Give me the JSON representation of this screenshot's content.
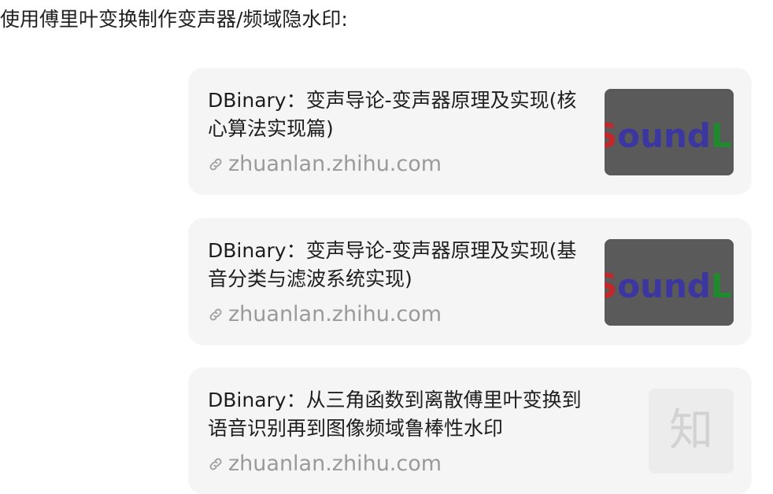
{
  "intro": "使用傅里叶变换制作变声器/频域隐水印:",
  "cards": [
    {
      "author": "DBinary",
      "sep": "：",
      "title": "变声导论-变声器原理及实现(核心算法实现篇)",
      "url": "zhuanlan.zhihu.com",
      "thumb_text": "SoundLa",
      "thumb_kind": "soundlab"
    },
    {
      "author": "DBinary",
      "sep": "：",
      "title": "变声导论-变声器原理及实现(基音分类与滤波系统实现)",
      "url": "zhuanlan.zhihu.com",
      "thumb_text": "SoundLa",
      "thumb_kind": "soundlab"
    },
    {
      "author": "DBinary",
      "sep": "：",
      "title": "从三角函数到离散傅里叶变换到语音识别再到图像频域鲁棒性水印",
      "url": "zhuanlan.zhihu.com",
      "thumb_text": "知",
      "thumb_kind": "zhihu-placeholder"
    }
  ],
  "colors": {
    "card_bg": "#f5f5f6",
    "link": "#9a9a9a",
    "thumb_bg": "#5a5a5a",
    "thumb_red": "#c0282b",
    "thumb_blue": "#3c36a0",
    "thumb_green": "#1f8a2e"
  },
  "icons": {
    "link": "link-icon"
  }
}
